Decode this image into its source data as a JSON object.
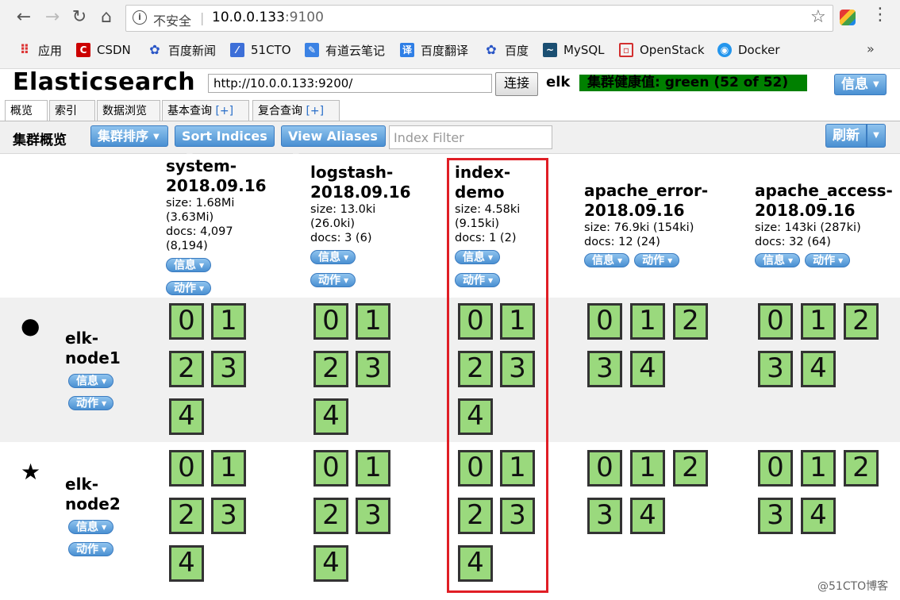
{
  "browser": {
    "address_insecure": "不安全",
    "address_host": "10.0.0.133",
    "address_port": ":9100",
    "bookmarks": [
      "应用",
      "CSDN",
      "百度新闻",
      "51CTO",
      "有道云笔记",
      "百度翻译",
      "百度",
      "MySQL",
      "OpenStack",
      "Docker"
    ],
    "bookmarks_more": "»"
  },
  "app": {
    "title": "Elasticsearch",
    "connect_url": "http://10.0.0.133:9200/",
    "connect_label": "连接",
    "cluster_name": "elk",
    "health_text": "集群健康值: green (52 of 52)",
    "info_label": "信息",
    "health_color": "#008000"
  },
  "tabs": [
    {
      "label": "概览",
      "plus": ""
    },
    {
      "label": "索引",
      "plus": ""
    },
    {
      "label": "数据浏览",
      "plus": ""
    },
    {
      "label": "基本查询 ",
      "plus": "[+]"
    },
    {
      "label": "复合查询 ",
      "plus": "[+]"
    }
  ],
  "toolbar": {
    "title": "集群概览",
    "sort_cluster": "集群排序",
    "sort_indices": "Sort Indices",
    "view_aliases": "View Aliases",
    "filter_placeholder": "Index Filter",
    "refresh": "刷新"
  },
  "indices": [
    {
      "name_line1": "system-",
      "name_line2": "2018.09.16",
      "stat_lines": [
        "size: 1.68Mi",
        "(3.63Mi)",
        "docs: 4,097",
        "(8,194)"
      ]
    },
    {
      "name_line1": "logstash-",
      "name_line2": "2018.09.16",
      "stat_lines": [
        "size: 13.0ki",
        "(26.0ki)",
        "docs: 3 (6)"
      ]
    },
    {
      "name_line1": "index-",
      "name_line2": "demo",
      "stat_lines": [
        "size: 4.58ki",
        "(9.15ki)",
        "docs: 1 (2)"
      ]
    },
    {
      "name_line1": "apache_error-",
      "name_line2": "2018.09.16",
      "stat_lines": [
        "size: 76.9ki (154ki)",
        "docs: 12 (24)"
      ]
    },
    {
      "name_line1": "apache_access-",
      "name_line2": "2018.09.16",
      "stat_lines": [
        "size: 143ki (287ki)",
        "docs: 32 (64)"
      ]
    }
  ],
  "pill_labels": {
    "info": "信息",
    "action": "动作"
  },
  "nodes": [
    {
      "marker": "●",
      "name_line1": "elk-",
      "name_line2": "node1"
    },
    {
      "marker": "★",
      "name_line1": "elk-",
      "name_line2": "node2"
    }
  ],
  "shard_labels": [
    "0",
    "1",
    "2",
    "3",
    "4"
  ],
  "shard_color": "#9ad97d",
  "highlight_color": "#e01e25",
  "watermark": "@51CTO博客"
}
